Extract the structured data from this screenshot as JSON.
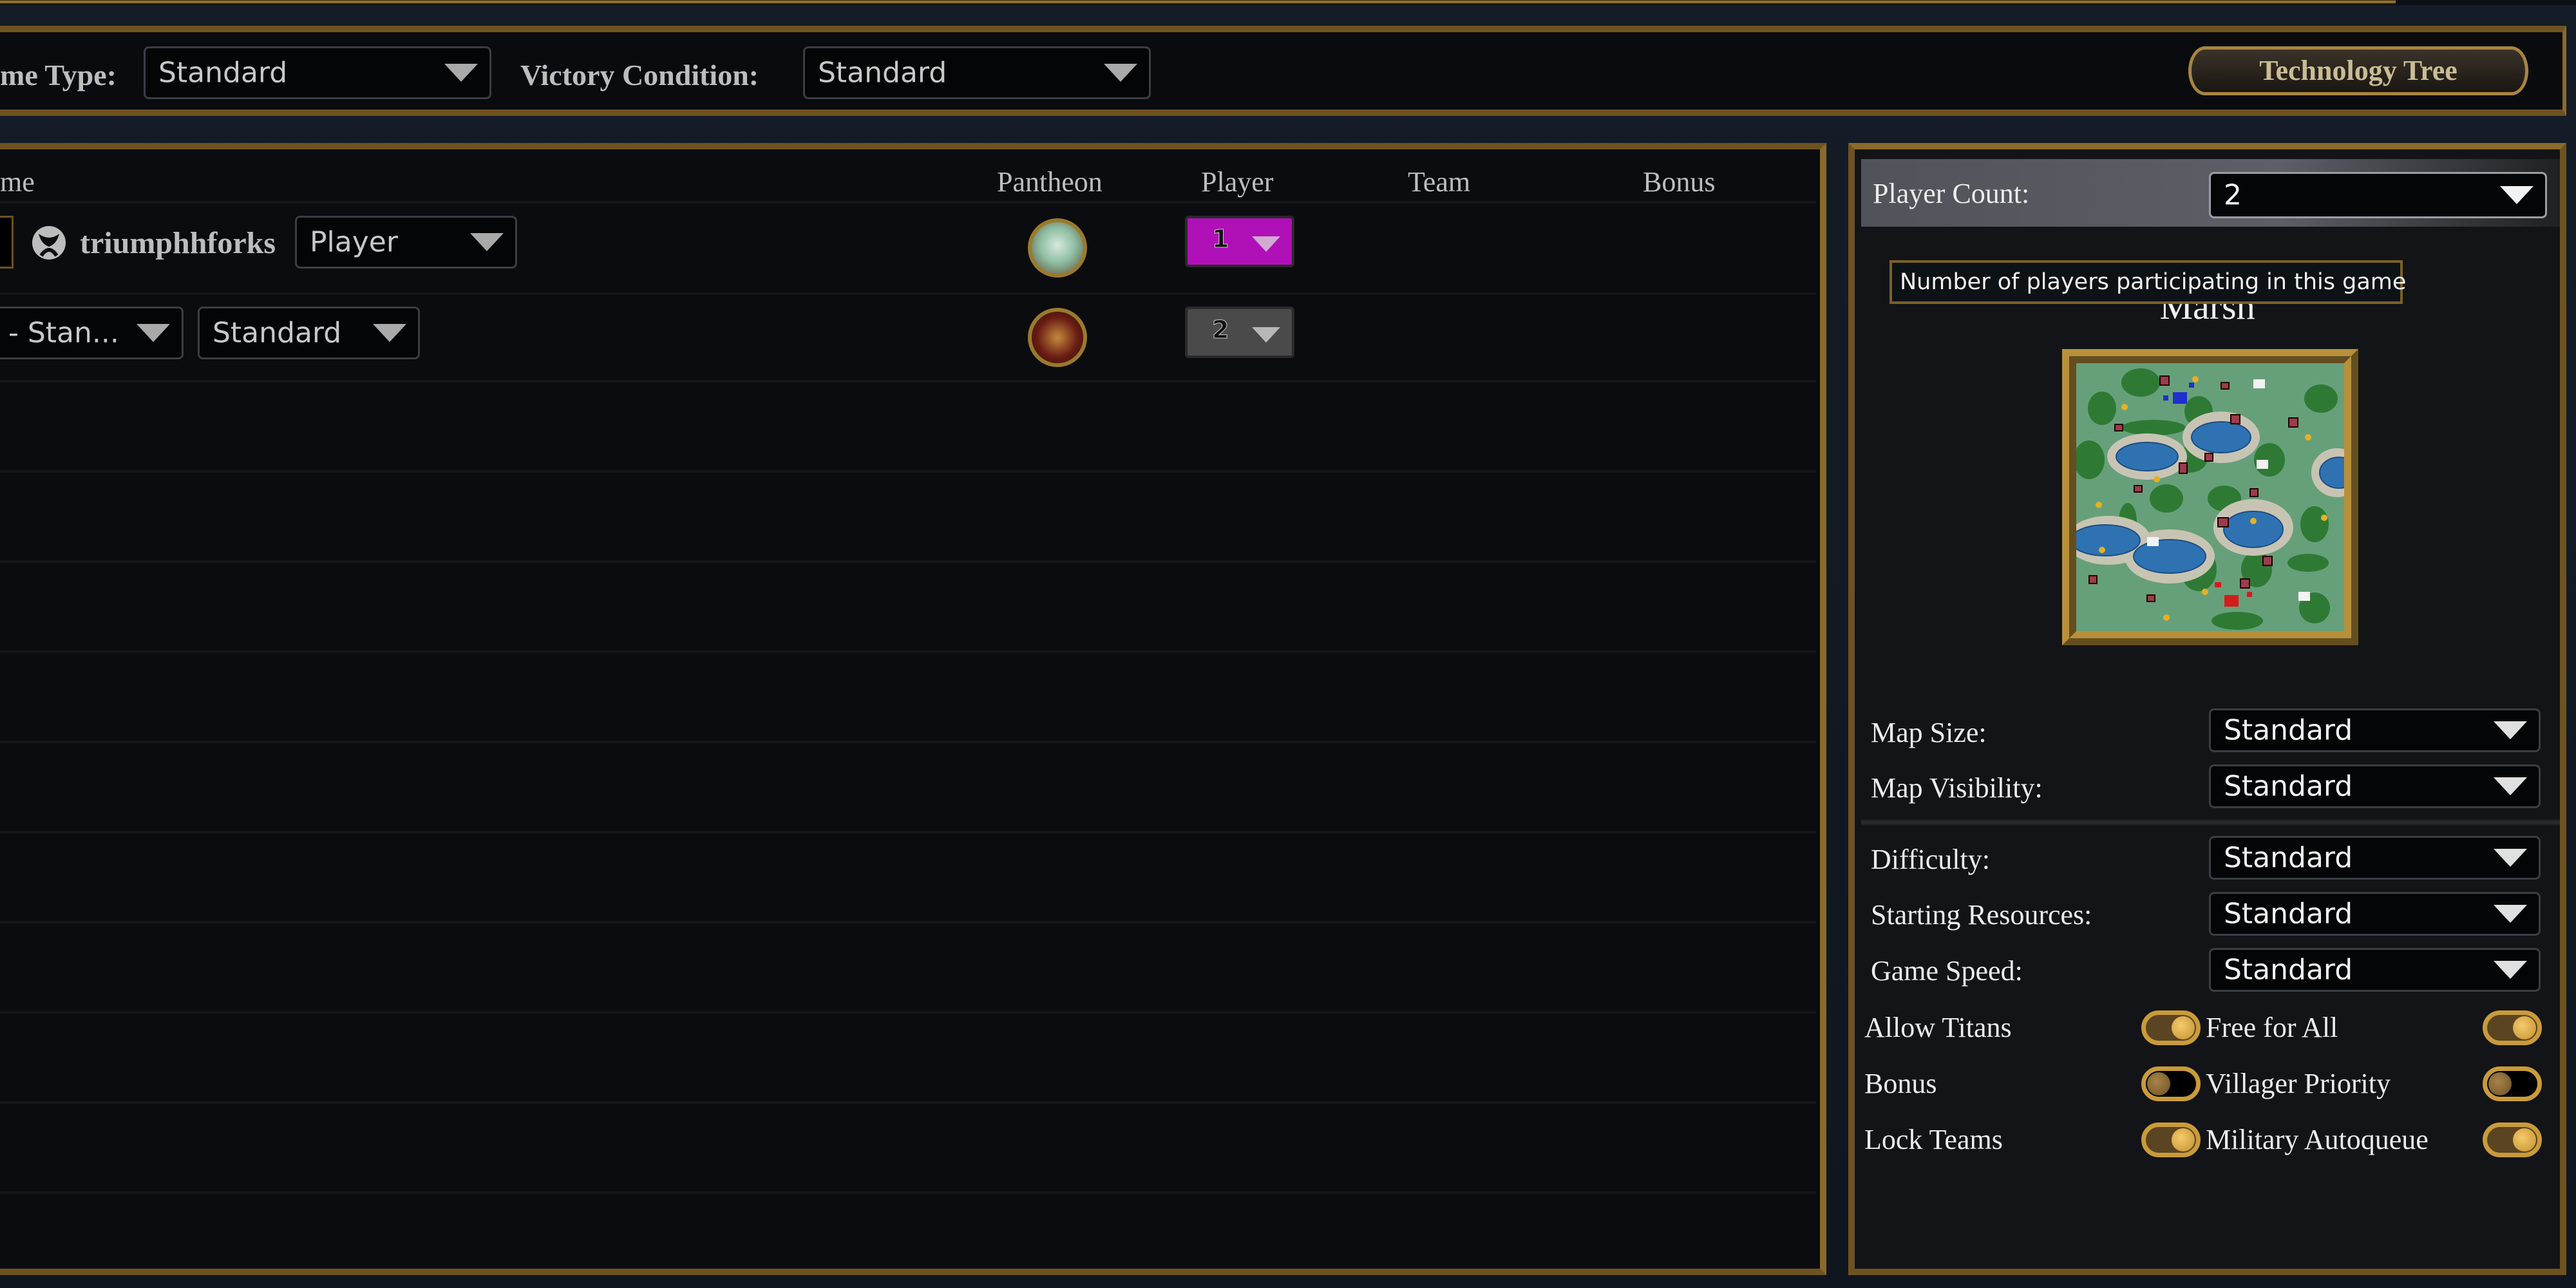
{
  "settings_bar": {
    "game_type_label": "me Type:",
    "game_type_value": "Standard",
    "victory_condition_label": "Victory Condition:",
    "victory_condition_value": "Standard",
    "tech_tree_button": "Technology Tree"
  },
  "players_table": {
    "columns": {
      "name": "me",
      "pantheon": "Pantheon",
      "player": "Player",
      "team": "Team",
      "bonus": "Bonus"
    },
    "rows": [
      {
        "platform_icon": "xbox-icon",
        "name": "triumphhforks",
        "type_value": "Player",
        "pantheon_icon": "zeus-portrait-icon",
        "player_number": "1",
        "player_color": "#b010b8"
      },
      {
        "ai_value": "- Stan...",
        "difficulty_value": "Standard",
        "pantheon_icon": "hades-helmet-icon",
        "player_number": "2",
        "player_color": "#4a4a4a"
      }
    ]
  },
  "game_settings": {
    "player_count_label": "Player Count:",
    "player_count_value": "2",
    "tooltip": "Number of players participating in this game",
    "map_name": "Marsh",
    "dropdowns": [
      {
        "label": "Map Size:",
        "value": "Standard"
      },
      {
        "label": "Map Visibility:",
        "value": "Standard"
      },
      {
        "label": "Difficulty:",
        "value": "Standard"
      },
      {
        "label": "Starting Resources:",
        "value": "Standard"
      },
      {
        "label": "Game Speed:",
        "value": "Standard"
      }
    ],
    "toggles": [
      {
        "label": "Allow Titans",
        "on": true
      },
      {
        "label": "Free for All",
        "on": true
      },
      {
        "label": "Bonus",
        "on": false
      },
      {
        "label": "Villager Priority",
        "on": false
      },
      {
        "label": "Lock Teams",
        "on": true
      },
      {
        "label": "Military Autoqueue",
        "on": true
      }
    ]
  }
}
